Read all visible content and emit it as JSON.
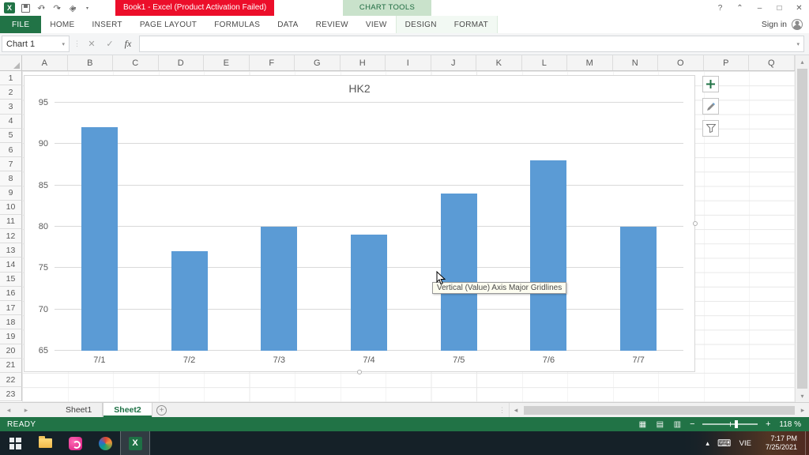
{
  "titlebar": {
    "title": "Book1 -  Excel (Product Activation Failed)",
    "chart_tools": "CHART TOOLS"
  },
  "ribbon": {
    "tabs": [
      {
        "label": "FILE",
        "style": "file"
      },
      {
        "label": "HOME",
        "style": "normal"
      },
      {
        "label": "INSERT",
        "style": "normal"
      },
      {
        "label": "PAGE LAYOUT",
        "style": "normal"
      },
      {
        "label": "FORMULAS",
        "style": "normal"
      },
      {
        "label": "DATA",
        "style": "normal"
      },
      {
        "label": "REVIEW",
        "style": "normal"
      },
      {
        "label": "VIEW",
        "style": "normal"
      },
      {
        "label": "DESIGN",
        "style": "contextual"
      },
      {
        "label": "FORMAT",
        "style": "contextual"
      }
    ],
    "sign_in": "Sign in"
  },
  "formula_bar": {
    "name_box": "Chart 1",
    "fx_label": "fx",
    "formula_value": ""
  },
  "grid": {
    "columns": [
      "A",
      "B",
      "C",
      "D",
      "E",
      "F",
      "G",
      "H",
      "I",
      "J",
      "K",
      "L",
      "M",
      "N",
      "O",
      "P",
      "Q"
    ],
    "rows": [
      "1",
      "2",
      "3",
      "4",
      "5",
      "6",
      "7",
      "8",
      "9",
      "10",
      "11",
      "12",
      "13",
      "14",
      "15",
      "16",
      "17",
      "18",
      "19",
      "20",
      "21",
      "22",
      "23"
    ]
  },
  "chart_data": {
    "type": "bar",
    "title": "HK2",
    "categories": [
      "7/1",
      "7/2",
      "7/3",
      "7/4",
      "7/5",
      "7/6",
      "7/7"
    ],
    "values": [
      92,
      77,
      80,
      79,
      84,
      88,
      80
    ],
    "xlabel": "",
    "ylabel": "",
    "ylim": [
      65,
      95
    ],
    "yticks": [
      65,
      70,
      75,
      80,
      85,
      90,
      95
    ],
    "bar_color": "#5B9BD5",
    "grid": true,
    "legend_position": "none"
  },
  "tooltip": {
    "text": "Vertical (Value) Axis Major Gridlines"
  },
  "sheet_bar": {
    "tabs": [
      {
        "label": "Sheet1",
        "active": false
      },
      {
        "label": "Sheet2",
        "active": true
      }
    ]
  },
  "status_bar": {
    "mode": "READY",
    "zoom_label": "118 %"
  },
  "taskbar": {
    "language": "VIE",
    "time": "7:17 PM",
    "date": "7/25/2021"
  },
  "icons": {
    "excel_letter": "X",
    "help": "?",
    "ribbon_options": "⌃",
    "minimize": "–",
    "maximize": "□",
    "close": "✕",
    "undo": "↶",
    "redo": "↷",
    "caret": "▾",
    "qat_extra": "◈",
    "cancel": "✕",
    "enter": "✓",
    "dots": "⋮",
    "nav_left": "◂",
    "nav_right": "▸",
    "add_sheet": "+",
    "scroll_up": "▴",
    "scroll_down": "▾",
    "scroll_left": "◂",
    "scroll_right": "▸",
    "view_normal": "▦",
    "view_layout": "▤",
    "view_break": "▥",
    "zoom_out": "−",
    "zoom_in": "+",
    "tray_chevron": "▴",
    "keyboard": "⌨"
  }
}
